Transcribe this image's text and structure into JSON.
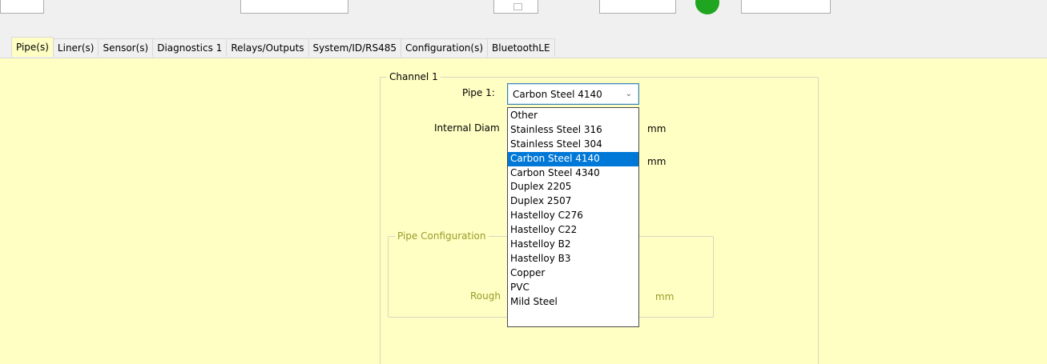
{
  "tabs": [
    {
      "label": "Pipe(s)",
      "active": true
    },
    {
      "label": "Liner(s)",
      "active": false
    },
    {
      "label": "Sensor(s)",
      "active": false
    },
    {
      "label": "Diagnostics 1",
      "active": false
    },
    {
      "label": "Relays/Outputs",
      "active": false
    },
    {
      "label": "System/ID/RS485",
      "active": false
    },
    {
      "label": "Configuration(s)",
      "active": false
    },
    {
      "label": "BluetoothLE",
      "active": false
    }
  ],
  "channel": {
    "legend": "Channel 1",
    "pipe_label": "Pipe 1:",
    "pipe_value": "Carbon Steel 4140",
    "internal_diameter_label": "Internal Diam",
    "unit_1": "mm",
    "unit_2": "mm"
  },
  "pipe_configuration": {
    "legend": "Pipe Configuration",
    "roughness_label": "Rough",
    "unit": "mm"
  },
  "pipe_options": [
    "Other",
    "Stainless Steel 316",
    "Stainless Steel 304",
    "Carbon Steel 4140",
    "Carbon Steel 4340",
    "Duplex 2205",
    "Duplex 2507",
    "Hastelloy C276",
    "Hastelloy C22",
    "Hastelloy B2",
    "Hastelloy B3",
    "Copper",
    "PVC",
    "Mild Steel"
  ],
  "selected_index": 3,
  "icons": {
    "status": "status-led-icon",
    "dropdown": "chevron-down-icon",
    "calendar": "calendar-icon"
  },
  "colors": {
    "panel_background": "#ffffc4",
    "selection": "#0078d7",
    "status_led": "#1fa51f",
    "disabled_text": "#9a9a2a"
  }
}
